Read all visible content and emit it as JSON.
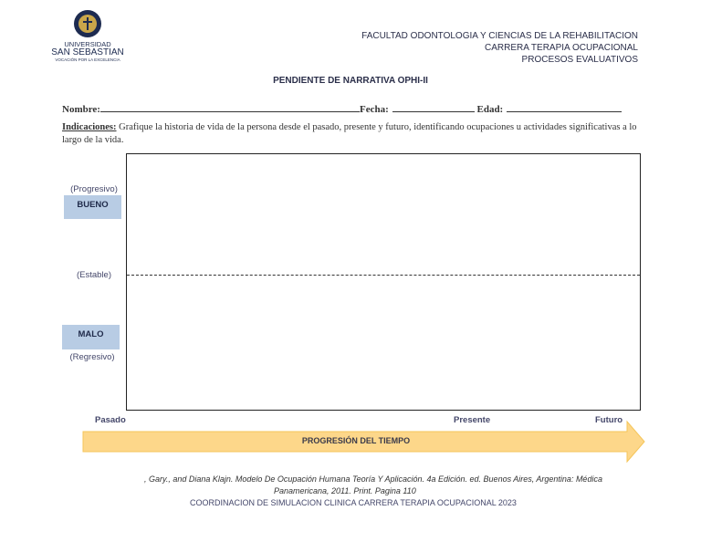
{
  "logo": {
    "name": "UNIVERSIDAD",
    "name2": "SAN SEBASTIAN",
    "tagline": "VOCACIÓN POR LA EXCELENCIA"
  },
  "header": {
    "line1": "FACULTAD ODONTOLOGIA Y CIENCIAS DE LA REHABILITACION",
    "line2": "CARRERA TERAPIA OCUPACIONAL",
    "line3": "PROCESOS EVALUATIVOS"
  },
  "title": "PENDIENTE DE NARRATIVA OPHI-II",
  "form": {
    "nombre": "Nombre:",
    "fecha": "Fecha:",
    "edad": "Edad:"
  },
  "instructions": {
    "label": "Indicaciones:",
    "text": " Grafique la historia de vida de la persona desde el pasado, presente y futuro, identificando ocupaciones u actividades significativas a lo largo de la vida."
  },
  "yaxis": {
    "progresivo": "(Progresivo)",
    "bueno": "BUENO",
    "estable": "(Estable)",
    "malo": "MALO",
    "regresivo": "(Regresivo)"
  },
  "xaxis": {
    "pasado": "Pasado",
    "presente": "Presente",
    "futuro": "Futuro",
    "arrow": "PROGRESIÓN DEL TIEMPO"
  },
  "footer": {
    "citation1": ", Gary., and Diana Klajn. Modelo De Ocupación Humana Teoría Y Aplicación. 4a Edición. ed. Buenos Aires, Argentina: Médica",
    "citation2": "Panamericana, 2011. Print. Pagina 110",
    "coord": "COORDINACION DE SIMULACION CLINICA CARRERA TERAPIA OCUPACIONAL 2023"
  }
}
